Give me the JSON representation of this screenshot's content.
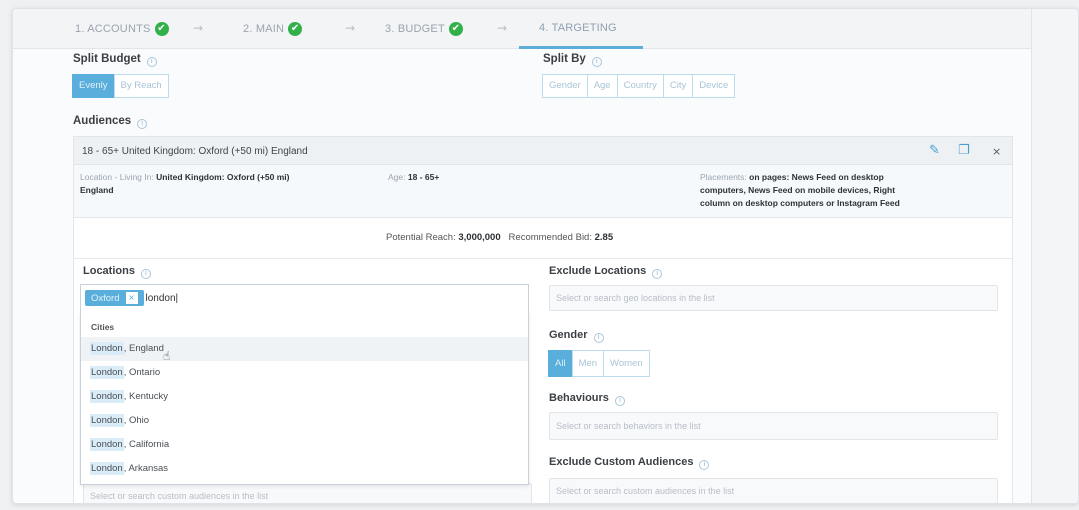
{
  "steps": [
    {
      "label": "1. ACCOUNTS",
      "done": true
    },
    {
      "label": "2. MAIN",
      "done": true
    },
    {
      "label": "3. BUDGET",
      "done": true
    },
    {
      "label": "4. TARGETING",
      "done": false
    }
  ],
  "step_arrow": "→",
  "check_glyph": "✔",
  "split_budget": {
    "label": "Split Budget",
    "options": [
      "Evenly",
      "By Reach"
    ],
    "selected": "Evenly"
  },
  "split_by": {
    "label": "Split By",
    "options": [
      "Gender",
      "Age",
      "Country",
      "City",
      "Device"
    ]
  },
  "audiences": {
    "label": "Audiences",
    "title": "18 - 65+ United Kingdom: Oxford (+50 mi) England",
    "location_prefix": "Location - Living In:",
    "location_value": "United Kingdom: Oxford (+50 mi)",
    "location_value_2": "England",
    "age_prefix": "Age:",
    "age_value": "18 - 65+",
    "placements_prefix": "Placements:",
    "placements_value_1": "on pages: News Feed on desktop",
    "placements_value_2": "computers, News Feed on mobile devices, Right",
    "placements_value_3": "column on desktop computers or Instagram Feed",
    "potential_reach_label": "Potential Reach:",
    "potential_reach_value": "3,000,000",
    "recommended_bid_label": "Recommended Bid:",
    "recommended_bid_value": "2.85",
    "edit_icon": "✎",
    "copy_icon": "❐",
    "close_icon": "×"
  },
  "locations": {
    "label": "Locations",
    "tag": "Oxford",
    "tag_remove": "×",
    "typed": "london|",
    "dropdown_header": "Cities",
    "suggestions": [
      {
        "match": "London",
        "rest": ", England"
      },
      {
        "match": "London",
        "rest": ", Ontario"
      },
      {
        "match": "London",
        "rest": ", Kentucky"
      },
      {
        "match": "London",
        "rest": ", Ohio"
      },
      {
        "match": "London",
        "rest": ", California"
      },
      {
        "match": "London",
        "rest": ", Arkansas"
      }
    ]
  },
  "custom_audiences_left_placeholder": "Select or search custom audiences in the list",
  "exclude_locations": {
    "label": "Exclude Locations",
    "placeholder": "Select or search geo locations in the list"
  },
  "gender": {
    "label": "Gender",
    "options": [
      "All",
      "Men",
      "Women"
    ],
    "selected": "All"
  },
  "behaviours": {
    "label": "Behaviours",
    "placeholder": "Select or search behaviors in the list"
  },
  "exclude_custom_audiences": {
    "label": "Exclude Custom Audiences",
    "placeholder": "Select or search custom audiences in the list"
  },
  "cursor_glyph": "☝",
  "colors": {
    "accent": "#5aaedb",
    "check": "#34b04a"
  }
}
